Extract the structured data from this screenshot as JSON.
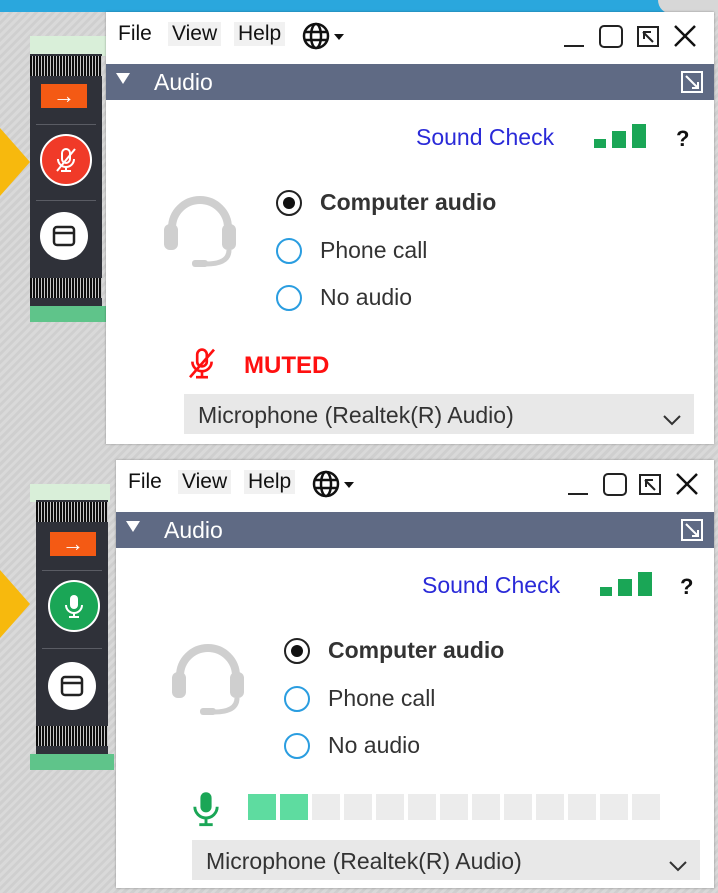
{
  "menu": {
    "file": "File",
    "view": "View",
    "help": "Help"
  },
  "panel_title": "Audio",
  "sound_check": "Sound Check",
  "help_mark": "?",
  "audio_options": [
    "Computer audio",
    "Phone call",
    "No audio"
  ],
  "selected_option": "Computer audio",
  "muted_label": "MUTED",
  "microphone": "Microphone (Realtek(R) Audio)",
  "mic_level": {
    "active_segments": 2,
    "total_segments": 13
  },
  "colors": {
    "header": "#5f6a84",
    "muted_red": "#ff1010",
    "mic_green": "#1aa656",
    "link_blue": "#2a2ad8",
    "signal_green": "#1aa656",
    "pointer": "#f7b90d",
    "arrow_orange": "#f45a14"
  },
  "icons": {
    "arrow": "→",
    "mic_muted": "mic-off-icon",
    "mic_on": "mic-icon",
    "window": "window-icon",
    "globe": "globe-icon",
    "headset": "headset-icon",
    "minimize": "minimize-icon",
    "maximize": "maximize-icon",
    "popout": "popout-icon",
    "close": "close-icon",
    "chevron": "chevron-down-icon"
  }
}
